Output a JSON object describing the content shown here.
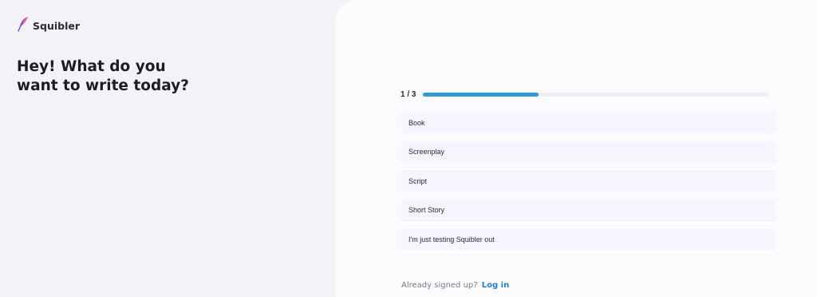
{
  "brand": {
    "name": "Squibler",
    "icon": "feather-icon"
  },
  "headline": "Hey! What do you want to write today?",
  "progress": {
    "label": "1 / 3",
    "fraction": 0.333,
    "color": "#2e9bd6"
  },
  "options": [
    {
      "label": "Book"
    },
    {
      "label": "Screenplay"
    },
    {
      "label": "Script"
    },
    {
      "label": "Short Story"
    },
    {
      "label": "I'm just testing Squibler out"
    }
  ],
  "footer": {
    "prompt": "Already signed up?",
    "link_label": "Log in"
  }
}
